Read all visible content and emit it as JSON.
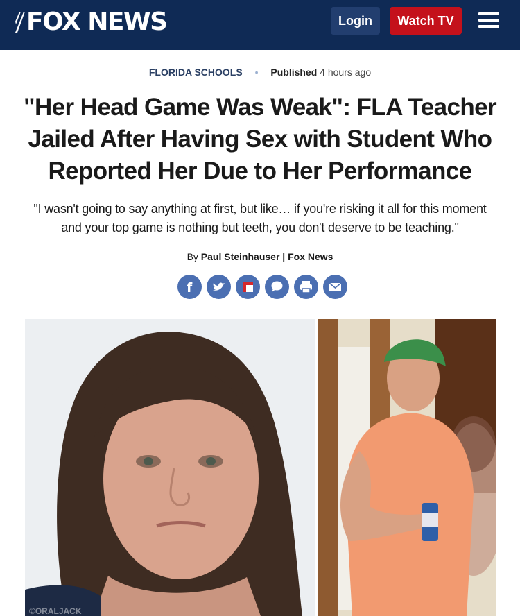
{
  "header": {
    "logo_text": "FOX NEWS",
    "login_label": "Login",
    "watch_label": "Watch TV",
    "menu_icon": "hamburger-menu-icon",
    "colors": {
      "bar": "#0f2a55",
      "login": "#223e6f",
      "watch": "#c4111b"
    }
  },
  "article": {
    "category": "FLORIDA SCHOOLS",
    "separator": "•",
    "published_label": "Published",
    "published_ago": "4 hours ago",
    "headline": "\"Her Head Game Was Weak\": FLA Teacher Jailed After Having Sex with Student Who Reported Her Due to Her Performance",
    "subheadline": "\"I wasn't going to say anything at first, but like… if you're risking it all for this moment and your top game is nothing but teeth, you don't deserve to be teaching.\"",
    "byline_prefix": "By",
    "author": "Paul Steinhauser | Fox News"
  },
  "share": [
    {
      "icon": "facebook-icon"
    },
    {
      "icon": "twitter-icon"
    },
    {
      "icon": "flipboard-icon"
    },
    {
      "icon": "comment-icon"
    },
    {
      "icon": "print-icon"
    },
    {
      "icon": "email-icon"
    }
  ],
  "photos": {
    "left": "mugshot-photo",
    "right": "young-man-photo",
    "watermark": "©ORALJACK"
  }
}
